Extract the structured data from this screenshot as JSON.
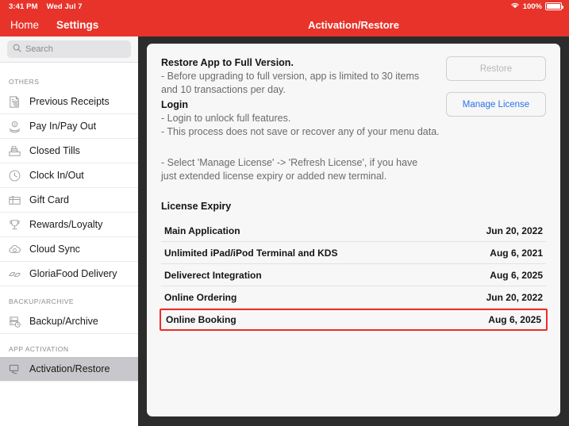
{
  "statusbar": {
    "time": "3:41 PM",
    "date": "Wed Jul 7",
    "battery_pct": "100%",
    "wifi_icon": "wifi-icon",
    "battery_icon": "battery-full-icon"
  },
  "navbar": {
    "home_label": "Home",
    "settings_label": "Settings",
    "title": "Activation/Restore",
    "background": "#e8332a"
  },
  "sidebar": {
    "search": {
      "placeholder": "Search",
      "value": "",
      "icon": "search-icon"
    },
    "sections": [
      {
        "header": "OTHERS",
        "items": [
          {
            "label": "Previous Receipts",
            "icon": "receipt-icon",
            "selected": false
          },
          {
            "label": "Pay In/Pay Out",
            "icon": "cash-hand-icon",
            "selected": false
          },
          {
            "label": "Closed Tills",
            "icon": "cash-register-icon",
            "selected": false
          },
          {
            "label": "Clock In/Out",
            "icon": "clock-icon",
            "selected": false
          },
          {
            "label": "Gift Card",
            "icon": "gift-card-icon",
            "selected": false
          },
          {
            "label": "Rewards/Loyalty",
            "icon": "trophy-icon",
            "selected": false
          },
          {
            "label": "Cloud Sync",
            "icon": "cloud-sync-icon",
            "selected": false
          },
          {
            "label": "GloriaFood Delivery",
            "icon": "leaf-icon",
            "selected": false
          }
        ]
      },
      {
        "header": "BACKUP/ARCHIVE",
        "items": [
          {
            "label": "Backup/Archive",
            "icon": "database-backup-icon",
            "selected": false
          }
        ]
      },
      {
        "header": "APP ACTIVATION",
        "items": [
          {
            "label": "Activation/Restore",
            "icon": "restore-device-icon",
            "selected": true
          }
        ]
      }
    ]
  },
  "content": {
    "restore_heading": "Restore App to Full Version.",
    "restore_line1": " - Before upgrading to full version, app is limited to 30 items",
    "restore_line2": "and 10 transactions per day.",
    "login_heading": "Login",
    "login_line1": " - Login to unlock full features.",
    "login_line2": " - This process does not save or recover any of your menu data.",
    "note_line1": " - Select 'Manage License' -> 'Refresh License', if you have",
    "note_line2": "just extended license expiry or added new terminal.",
    "buttons": {
      "restore": {
        "label": "Restore",
        "enabled": false,
        "color": "#b6b6ba"
      },
      "manage_license": {
        "label": "Manage License",
        "enabled": true,
        "color": "#2a72e8"
      }
    },
    "license_expiry_title": "License Expiry",
    "license_rows": [
      {
        "name": "Main Application",
        "date": "Jun 20, 2022",
        "highlighted": false
      },
      {
        "name": "Unlimited iPad/iPod Terminal and KDS",
        "date": "Aug 6, 2021",
        "highlighted": false
      },
      {
        "name": "Deliverect Integration",
        "date": "Aug 6, 2025",
        "highlighted": false
      },
      {
        "name": "Online Ordering",
        "date": "Jun 20, 2022",
        "highlighted": false
      },
      {
        "name": "Online Booking",
        "date": "Aug 6, 2025",
        "highlighted": true
      }
    ],
    "highlight_color": "#ef2b28"
  }
}
